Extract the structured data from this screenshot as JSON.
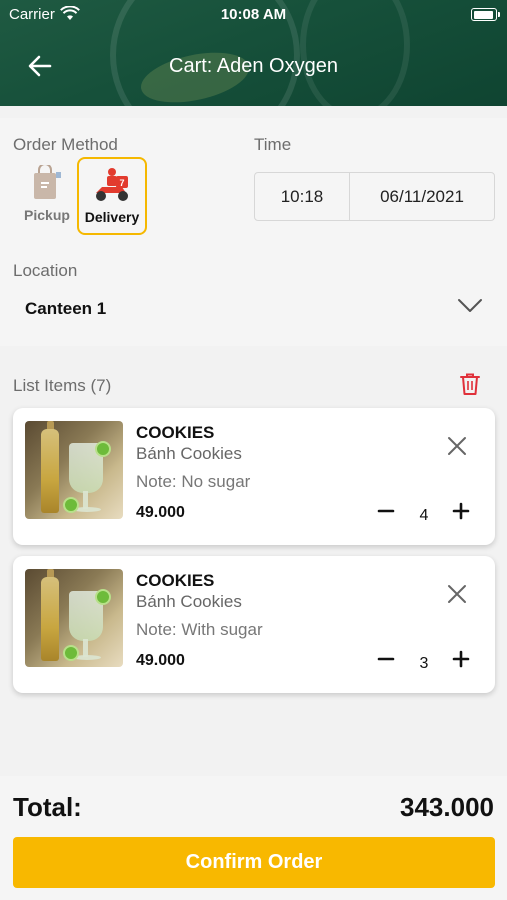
{
  "status_bar": {
    "carrier": "Carrier",
    "time": "10:08 AM"
  },
  "header": {
    "title": "Cart: Aden Oxygen"
  },
  "order_method": {
    "label": "Order Method",
    "options": [
      {
        "label": "Pickup",
        "selected": false
      },
      {
        "label": "Delivery",
        "selected": true
      }
    ]
  },
  "time": {
    "label": "Time",
    "time_value": "10:18",
    "date_value": "06/11/2021"
  },
  "location": {
    "label": "Location",
    "value": "Canteen 1"
  },
  "list": {
    "label": "List Items (7)",
    "items": [
      {
        "name": "COOKIES",
        "subtitle": "Bánh Cookies",
        "note": "Note: No sugar",
        "price": "49.000",
        "quantity": "4"
      },
      {
        "name": "COOKIES",
        "subtitle": "Bánh Cookies",
        "note": "Note: With sugar",
        "price": "49.000",
        "quantity": "3"
      }
    ]
  },
  "footer": {
    "total_label": "Total:",
    "total_value": "343.000",
    "confirm_label": "Confirm Order"
  },
  "colors": {
    "header_green": "#16503a",
    "accent_yellow": "#f8b800",
    "trash_red": "#e0303a"
  }
}
